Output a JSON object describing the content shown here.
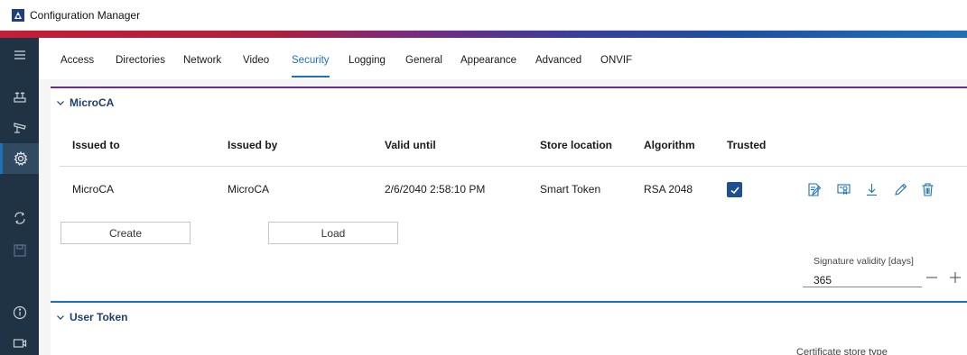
{
  "window": {
    "title": "Configuration Manager",
    "app_icon": "config-manager-logo"
  },
  "colors": {
    "accent": "#1d71b8",
    "sidebar_bg": "#1f3345",
    "microca_border": "#6a2c91",
    "usertoken_border": "#1d71b8",
    "checkbox": "#1d4f91"
  },
  "sidebar": {
    "items": [
      {
        "icon": "menu-icon"
      },
      {
        "icon": "network-devices-icon"
      },
      {
        "icon": "camera-icon"
      },
      {
        "icon": "gear-icon",
        "active": true
      },
      {
        "icon": "sync-icon"
      },
      {
        "icon": "save-icon"
      },
      {
        "icon": "info-icon"
      },
      {
        "icon": "monitor-icon"
      }
    ]
  },
  "tabs": [
    {
      "label": "Access"
    },
    {
      "label": "Directories"
    },
    {
      "label": "Network"
    },
    {
      "label": "Video"
    },
    {
      "label": "Security",
      "active": true
    },
    {
      "label": "Logging"
    },
    {
      "label": "General"
    },
    {
      "label": "Appearance"
    },
    {
      "label": "Advanced"
    },
    {
      "label": "ONVIF"
    }
  ],
  "microca": {
    "title": "MicroCA",
    "columns": [
      "Issued to",
      "Issued by",
      "Valid until",
      "Store location",
      "Algorithm",
      "Trusted"
    ],
    "rows": [
      {
        "issued_to": "MicroCA",
        "issued_by": "MicroCA",
        "valid_until": "2/6/2040 2:58:10 PM",
        "store_location": "Smart Token",
        "algorithm": "RSA 2048",
        "trusted": true
      }
    ],
    "row_actions": [
      "edit-certificate-icon",
      "view-certificate-icon",
      "download-icon",
      "pencil-icon",
      "trash-icon"
    ],
    "create_label": "Create",
    "load_label": "Load",
    "signature_label": "Signature validity [days]",
    "signature_value": "365"
  },
  "user_token": {
    "title": "User Token",
    "cert_store_label": "Certificate store type"
  }
}
